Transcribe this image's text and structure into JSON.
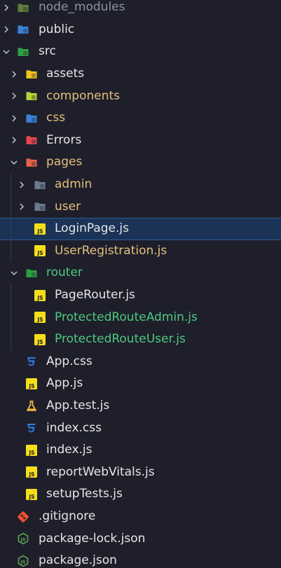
{
  "tree": [
    {
      "label": "node_modules",
      "depth": 0,
      "kind": "folder",
      "icon": "node-modules-folder-icon",
      "color": "#8e92a3",
      "iconColor": "#8dc149",
      "chevron": "right",
      "faded": true
    },
    {
      "label": "public",
      "depth": 0,
      "kind": "folder",
      "icon": "public-folder-icon",
      "color": "#e6e6e6",
      "iconColor": "#3b82d6",
      "chevron": "right"
    },
    {
      "label": "src",
      "depth": 0,
      "kind": "folder",
      "icon": "src-folder-icon",
      "color": "#e6e6e6",
      "iconColor": "#2ea043",
      "chevron": "down"
    },
    {
      "label": "assets",
      "depth": 1,
      "kind": "folder",
      "icon": "assets-folder-icon",
      "color": "#e6e6e6",
      "iconColor": "#f0c419",
      "chevron": "right"
    },
    {
      "label": "components",
      "depth": 1,
      "kind": "folder",
      "icon": "components-folder-icon",
      "color": "#e5c07b",
      "iconColor": "#b7d334",
      "chevron": "right"
    },
    {
      "label": "css",
      "depth": 1,
      "kind": "folder",
      "icon": "css-folder-icon",
      "color": "#e5c07b",
      "iconColor": "#3b82d6",
      "chevron": "right"
    },
    {
      "label": "Errors",
      "depth": 1,
      "kind": "folder",
      "icon": "errors-folder-icon",
      "color": "#e6e6e6",
      "iconColor": "#e5484d",
      "chevron": "right"
    },
    {
      "label": "pages",
      "depth": 1,
      "kind": "folder",
      "icon": "pages-folder-icon",
      "color": "#e5c07b",
      "iconColor": "#e5624d",
      "chevron": "down"
    },
    {
      "label": "admin",
      "depth": 2,
      "kind": "folder",
      "icon": "admin-folder-icon",
      "color": "#e5c07b",
      "iconColor": "#6b7b8c",
      "chevron": "right"
    },
    {
      "label": "user",
      "depth": 2,
      "kind": "folder",
      "icon": "user-folder-icon",
      "color": "#e5c07b",
      "iconColor": "#6b7b8c",
      "chevron": "right"
    },
    {
      "label": "LoginPage.js",
      "depth": 2,
      "kind": "js",
      "icon": "js-file-icon",
      "color": "#e6e6e6",
      "selected": true
    },
    {
      "label": "UserRegistration.js",
      "depth": 2,
      "kind": "js",
      "icon": "js-file-icon",
      "color": "#e5c07b"
    },
    {
      "label": "router",
      "depth": 1,
      "kind": "folder",
      "icon": "router-folder-icon",
      "color": "#4ec97f",
      "iconColor": "#2ea043",
      "chevron": "down"
    },
    {
      "label": "PageRouter.js",
      "depth": 2,
      "kind": "js",
      "icon": "js-file-icon",
      "color": "#e6e6e6",
      "noChevronIndent": true
    },
    {
      "label": "ProtectedRouteAdmin.js",
      "depth": 2,
      "kind": "js",
      "icon": "js-file-icon",
      "color": "#4ec97f",
      "noChevronIndent": true
    },
    {
      "label": "ProtectedRouteUser.js",
      "depth": 2,
      "kind": "js",
      "icon": "js-file-icon",
      "color": "#4ec97f",
      "noChevronIndent": true
    },
    {
      "label": "App.css",
      "depth": 1,
      "kind": "css",
      "icon": "css-file-icon",
      "color": "#e6e6e6"
    },
    {
      "label": "App.js",
      "depth": 1,
      "kind": "js",
      "icon": "js-file-icon",
      "color": "#e6e6e6"
    },
    {
      "label": "App.test.js",
      "depth": 1,
      "kind": "test",
      "icon": "test-flask-icon",
      "color": "#e6e6e6"
    },
    {
      "label": "index.css",
      "depth": 1,
      "kind": "css",
      "icon": "css-file-icon",
      "color": "#e6e6e6"
    },
    {
      "label": "index.js",
      "depth": 1,
      "kind": "js",
      "icon": "js-file-icon",
      "color": "#e6e6e6"
    },
    {
      "label": "reportWebVitals.js",
      "depth": 1,
      "kind": "js",
      "icon": "js-file-icon",
      "color": "#e6e6e6"
    },
    {
      "label": "setupTests.js",
      "depth": 1,
      "kind": "js",
      "icon": "js-file-icon",
      "color": "#e6e6e6"
    },
    {
      "label": ".gitignore",
      "depth": 0,
      "kind": "git",
      "icon": "git-icon",
      "color": "#e6e6e6"
    },
    {
      "label": "package-lock.json",
      "depth": 0,
      "kind": "node",
      "icon": "nodejs-icon",
      "color": "#e6e6e6"
    },
    {
      "label": "package.json",
      "depth": 0,
      "kind": "node",
      "icon": "nodejs-icon",
      "color": "#e6e6e6"
    }
  ],
  "colors": {
    "background": "#1e1f2b",
    "selection": "#1a3356",
    "jsBadge": "#f5de19",
    "cssBlue": "#2f7de1",
    "gitRed": "#f05133",
    "nodeGreen": "#5fa04e"
  }
}
